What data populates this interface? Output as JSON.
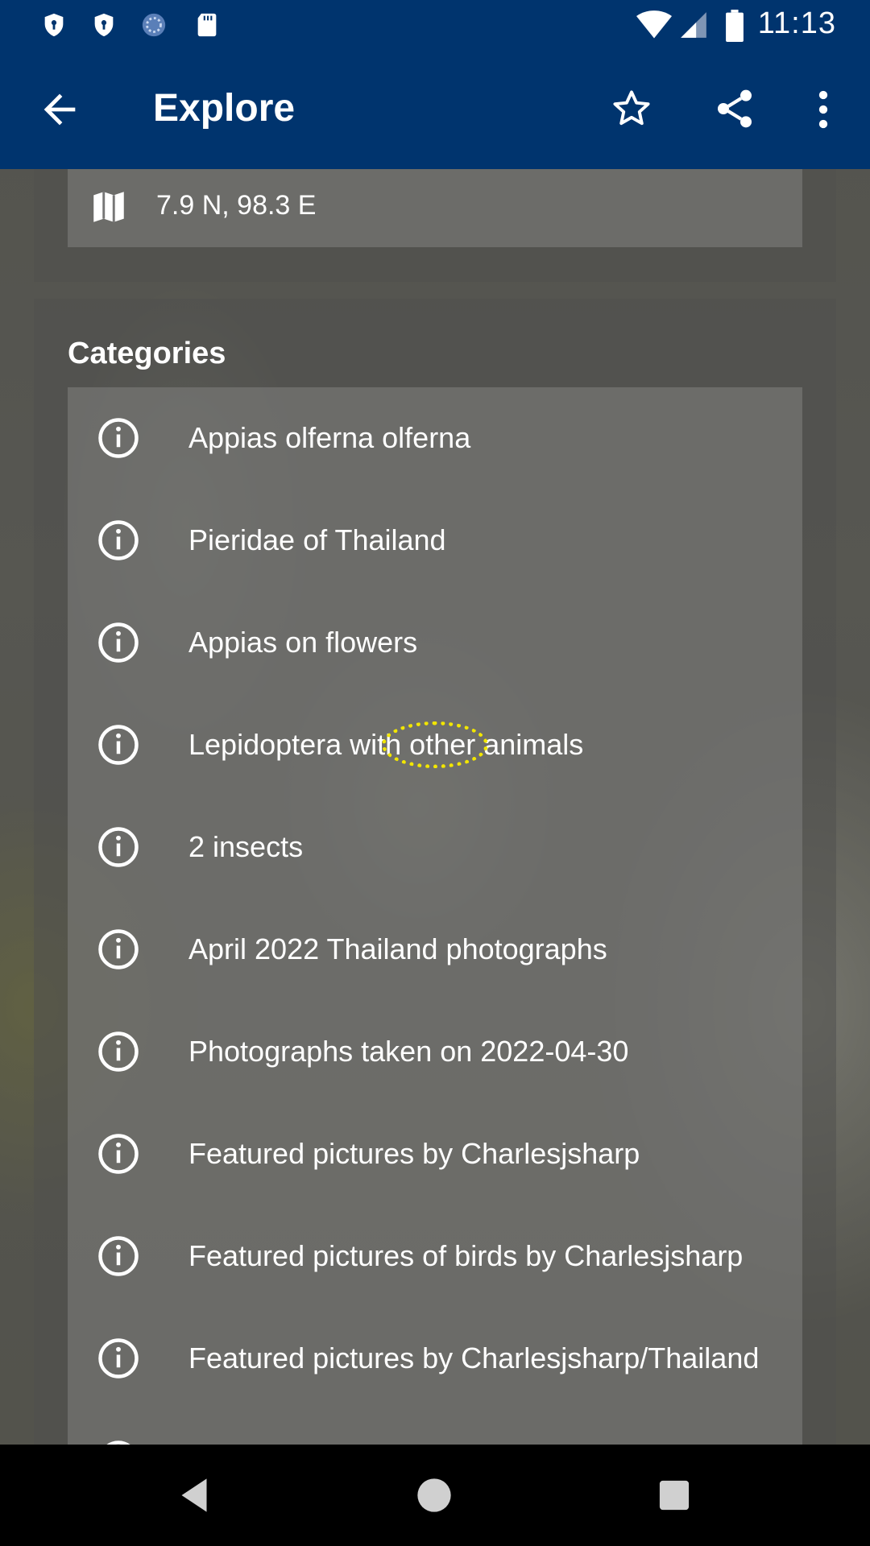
{
  "status_bar": {
    "time": "11:13",
    "icons": [
      "shield-icon",
      "shield-icon",
      "sync-icon",
      "sd-card-icon",
      "wifi-icon",
      "signal-icon",
      "battery-icon"
    ]
  },
  "app_bar": {
    "title": "Explore",
    "icons": [
      "back-arrow-icon",
      "star-icon",
      "share-icon",
      "more-vert-icon"
    ],
    "color": "#00346e"
  },
  "location": {
    "icon": "map-icon",
    "coordinates": "7.9 N, 98.3 E"
  },
  "categories": {
    "heading": "Categories",
    "items": [
      {
        "label": "Appias olferna olferna",
        "icon": "info-icon"
      },
      {
        "label": "Pieridae of Thailand",
        "icon": "info-icon"
      },
      {
        "label": "Appias on flowers",
        "icon": "info-icon"
      },
      {
        "label": "Lepidoptera with other animals",
        "icon": "info-icon"
      },
      {
        "label": "2 insects",
        "icon": "info-icon"
      },
      {
        "label": "April 2022 Thailand photographs",
        "icon": "info-icon"
      },
      {
        "label": "Photographs taken on 2022-04-30",
        "icon": "info-icon"
      },
      {
        "label": "Featured pictures by Charlesjsharp",
        "icon": "info-icon"
      },
      {
        "label": "Featured pictures of birds by Charlesjsharp",
        "icon": "info-icon"
      },
      {
        "label": "Featured pictures by Charlesjsharp/Thailand",
        "icon": "info-icon"
      }
    ]
  },
  "nav_bar": {
    "buttons": [
      "back-triangle-icon",
      "home-circle-icon",
      "recents-square-icon"
    ]
  },
  "highlight_color": "#f2e600"
}
